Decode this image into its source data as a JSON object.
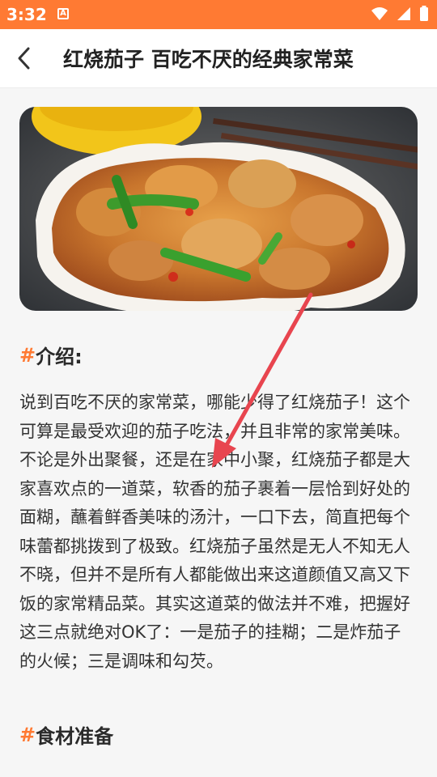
{
  "status": {
    "time": "3:32"
  },
  "header": {
    "title": "红烧茄子 百吃不厌的经典家常菜"
  },
  "sections": {
    "intro_heading": "介绍:",
    "intro_body": "说到百吃不厌的家常菜，哪能少得了红烧茄子！这个可算是最受欢迎的茄子吃法，并且非常的家常美味。不论是外出聚餐，还是在家中小聚，红烧茄子都是大家喜欢点的一道菜，软香的茄子裹着一层恰到好处的面糊，蘸着鲜香美味的汤汁，一口下去，简直把每个味蕾都挑拨到了极致。红烧茄子虽然是无人不知无人不晓，但并不是所有人都能做出来这道颜值又高又下饭的家常精品菜。其实这道菜的做法并不难，把握好这三点就绝对OK了：一是茄子的挂糊；二是炸茄子的火候；三是调味和勾芡。",
    "ingredients_heading": "食材准备",
    "hash_mark": "#"
  },
  "colors": {
    "status_bar": "#ff7a33",
    "accent": "#ff7a33",
    "arrow": "#e8454f"
  },
  "icons": {
    "back": "chevron-left-icon",
    "wifi": "wifi-icon",
    "signal": "signal-icon",
    "battery": "battery-icon"
  }
}
